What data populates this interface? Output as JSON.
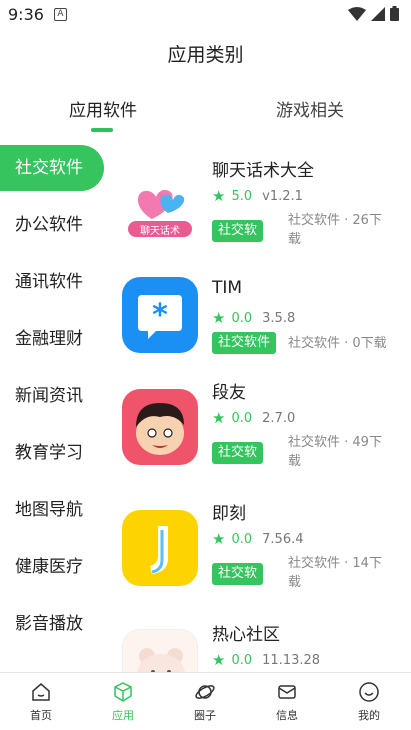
{
  "status_bar": {
    "time": "9:36",
    "notif_glyph": "A"
  },
  "page_title": "应用类别",
  "tabs": [
    {
      "label": "应用软件",
      "active": true
    },
    {
      "label": "游戏相关",
      "active": false
    }
  ],
  "sidebar": {
    "items": [
      {
        "label": "社交软件",
        "active": true
      },
      {
        "label": "办公软件"
      },
      {
        "label": "通讯软件"
      },
      {
        "label": "金融理财"
      },
      {
        "label": "新闻资讯"
      },
      {
        "label": "教育学习"
      },
      {
        "label": "地图导航"
      },
      {
        "label": "健康医疗"
      },
      {
        "label": "影音播放"
      }
    ]
  },
  "apps": [
    {
      "name": "聊天话术大全",
      "rating": "5.0",
      "version": "v1.2.1",
      "badge": "社交软",
      "info": "社交软件 · 26下载",
      "icon": "heart-chat-icon",
      "icon_text": "聊天话术"
    },
    {
      "name": "TIM",
      "rating": "0.0",
      "version": "3.5.8",
      "badge": "社交软件",
      "info": "社交软件 · 0下载",
      "icon": "tim-icon"
    },
    {
      "name": "段友",
      "rating": "0.0",
      "version": "2.7.0",
      "badge": "社交软",
      "info": "社交软件 · 49下载",
      "icon": "cartoon-face-icon"
    },
    {
      "name": "即刻",
      "rating": "0.0",
      "version": "7.56.4",
      "badge": "社交软",
      "info": "社交软件 · 14下载",
      "icon": "jike-icon"
    },
    {
      "name": "热心社区",
      "rating": "0.0",
      "version": "11.13.28",
      "icon": "bear-icon"
    }
  ],
  "bottom_nav": [
    {
      "label": "首页",
      "icon": "home-icon"
    },
    {
      "label": "应用",
      "icon": "box-icon",
      "active": true
    },
    {
      "label": "圈子",
      "icon": "planet-icon"
    },
    {
      "label": "信息",
      "icon": "mail-icon"
    },
    {
      "label": "我的",
      "icon": "smile-icon"
    }
  ],
  "colors": {
    "accent": "#35c45e",
    "text": "#222222",
    "muted": "#888888"
  }
}
